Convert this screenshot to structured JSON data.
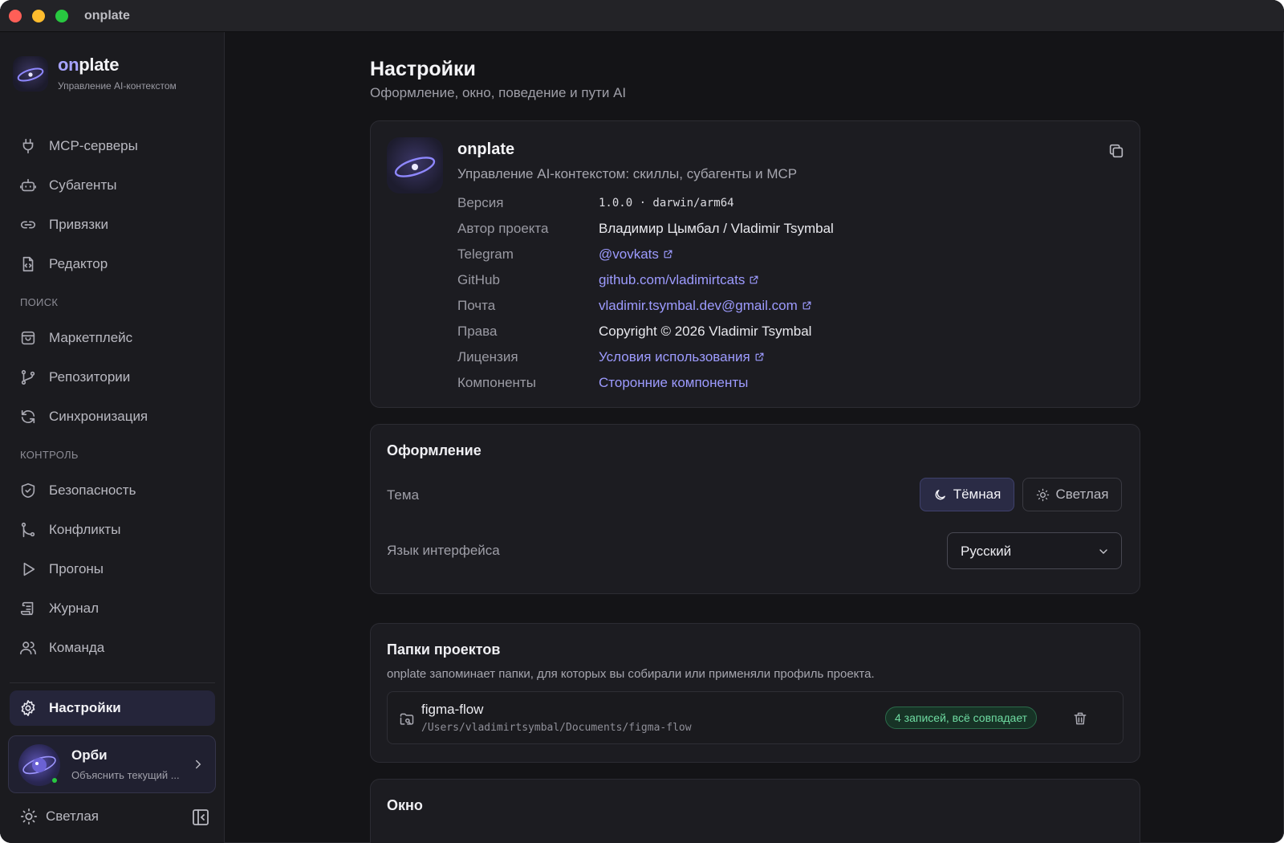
{
  "window": {
    "title": "onplate"
  },
  "brand": {
    "name_accent": "on",
    "name_rest": "plate",
    "subtitle": "Управление AI-контекстом"
  },
  "nav": {
    "items": [
      {
        "label": "MCP-серверы",
        "icon": "plug-icon"
      },
      {
        "label": "Субагенты",
        "icon": "robot-icon"
      },
      {
        "label": "Привязки",
        "icon": "link-icon"
      },
      {
        "label": "Редактор",
        "icon": "code-file-icon"
      }
    ],
    "section_search": "поиск",
    "search_items": [
      {
        "label": "Маркетплейс",
        "icon": "shopping-bag-icon"
      },
      {
        "label": "Репозитории",
        "icon": "git-branch-icon"
      },
      {
        "label": "Синхронизация",
        "icon": "sync-icon"
      }
    ],
    "section_control": "контроль",
    "control_items": [
      {
        "label": "Безопасность",
        "icon": "shield-icon"
      },
      {
        "label": "Конфликты",
        "icon": "git-merge-icon"
      },
      {
        "label": "Прогоны",
        "icon": "play-icon"
      },
      {
        "label": "Журнал",
        "icon": "scroll-icon"
      },
      {
        "label": "Команда",
        "icon": "users-icon"
      }
    ],
    "settings": {
      "label": "Настройки",
      "icon": "gear-icon"
    }
  },
  "orbi": {
    "name": "Орби",
    "subtitle": "Объяснить текущий ..."
  },
  "sidebar_footer": {
    "theme_label": "Светлая"
  },
  "page": {
    "title": "Настройки",
    "subtitle": "Оформление, окно, поведение и пути AI"
  },
  "about": {
    "name": "onplate",
    "description": "Управление AI-контекстом: скиллы, субагенты и MCP",
    "rows": [
      {
        "key": "Версия",
        "value": "1.0.0 · darwin/arm64"
      },
      {
        "key": "Автор проекта",
        "value": "Владимир Цымбал / Vladimir Tsymbal"
      },
      {
        "key": "Telegram",
        "value": "@vovkats"
      },
      {
        "key": "GitHub",
        "value": "github.com/vladimirtcats"
      },
      {
        "key": "Почта",
        "value": "vladimir.tsymbal.dev@gmail.com"
      },
      {
        "key": "Права",
        "value": "Copyright © 2026 Vladimir Tsymbal"
      },
      {
        "key": "Лицензия",
        "value": "Условия использования"
      },
      {
        "key": "Компоненты",
        "value": "Сторонние компоненты"
      }
    ]
  },
  "appearance": {
    "title": "Оформление",
    "theme_label": "Тема",
    "theme_dark": "Тёмная",
    "theme_light": "Светлая",
    "language_label": "Язык интерфейса",
    "language_value": "Русский"
  },
  "folders": {
    "title": "Папки проектов",
    "description": "onplate запоминает папки, для которых вы собирали или применяли профиль проекта.",
    "items": [
      {
        "name": "figma-flow",
        "path": "/Users/vladimirtsymbal/Documents/figma-flow",
        "badge": "4 записей, всё совпадает"
      }
    ]
  },
  "window_section": {
    "title": "Окно"
  },
  "colors": {
    "accent": "#9d9bff",
    "success": "#6fdca2",
    "background": "#141417",
    "card": "#1c1c21"
  }
}
